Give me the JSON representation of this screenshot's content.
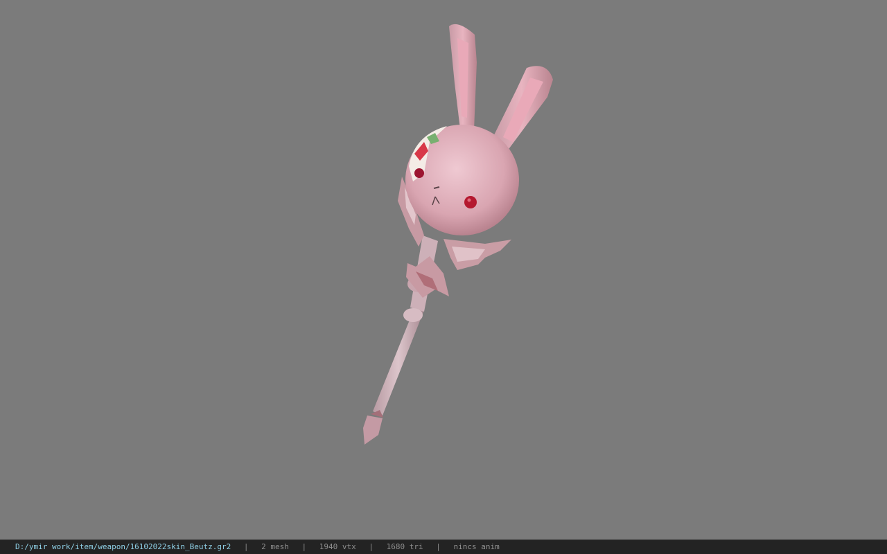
{
  "viewer": {
    "background_color": "#7b7b7b",
    "model_subject": "bunny-head staff weapon"
  },
  "status_bar": {
    "file_path": "D:/ymir work/item/weapon/16102022skin_Beutz.gr2",
    "separator": "|",
    "mesh_count": "2 mesh",
    "vertex_count": "1940 vtx",
    "triangle_count": "1680 tri",
    "anim_status": "nincs anim"
  }
}
